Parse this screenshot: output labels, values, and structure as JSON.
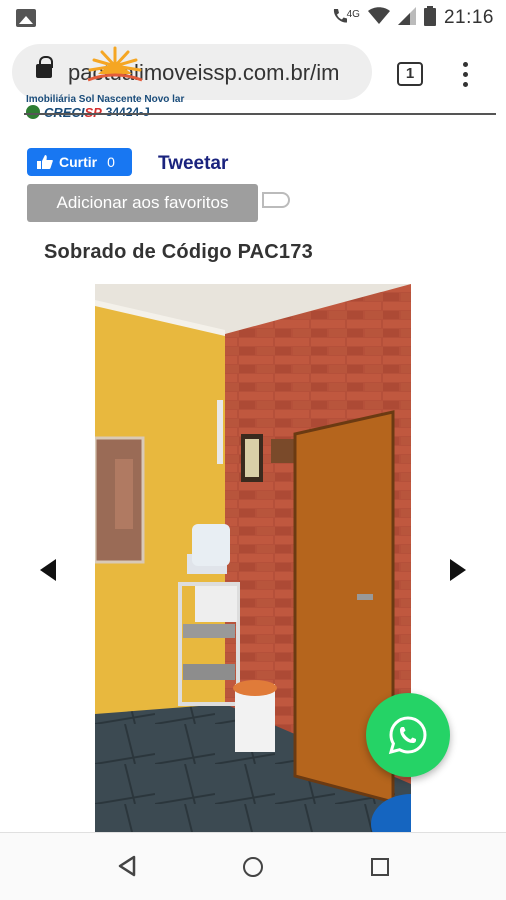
{
  "status_bar": {
    "time": "21:16",
    "network": "4G",
    "icons": [
      "gallery-icon",
      "phone-icon",
      "wifi-icon",
      "signal-icon",
      "battery-icon"
    ]
  },
  "browser": {
    "url": "pactualimoveissp.com.br/im",
    "tab_count": "1",
    "icons": [
      "lock-icon",
      "tabs-icon",
      "menu-icon"
    ]
  },
  "header": {
    "logo_tagline": "Imobiliária Sol Nascente Novo lar",
    "creci_brand": "CRECI",
    "creci_brand_suffix": "SP",
    "creci_number": "34424-J"
  },
  "social": {
    "like_label": "Curtir",
    "like_count": "0",
    "tweet_label": "Tweetar"
  },
  "favorites": {
    "button_label": "Adicionar aos favoritos"
  },
  "listing": {
    "title": "Sobrado de Código PAC173",
    "gallery_icons": [
      "arrow-left-icon",
      "arrow-right-icon"
    ]
  },
  "colors": {
    "facebook_blue": "#1877f2",
    "whatsapp_green": "#25d366",
    "tweet_link": "#1a237e",
    "favorites_button": "#9e9e9e"
  }
}
